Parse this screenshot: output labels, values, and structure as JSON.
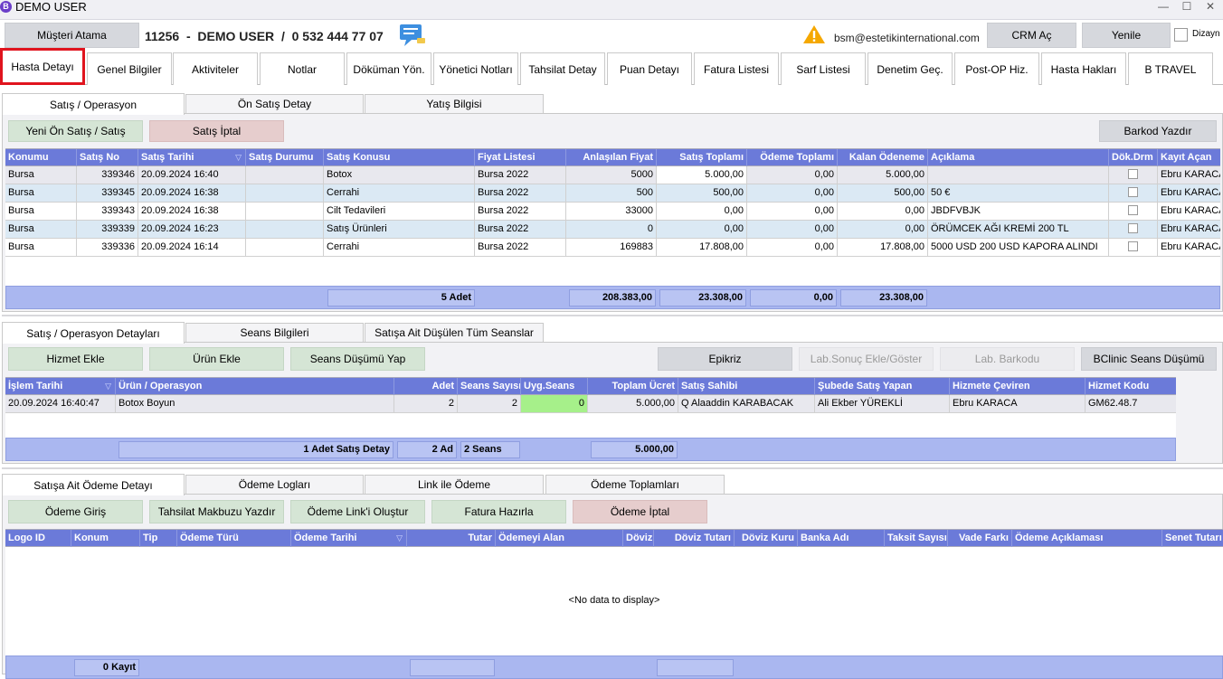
{
  "window": {
    "title": "DEMO USER",
    "logo_letter": "B",
    "minimize": "—",
    "maximize": "☐",
    "close": "✕"
  },
  "top": {
    "musteri_atama": "Müşteri Atama",
    "patient_line": "11256  -  DEMO USER  /  0 532 444 77 07",
    "email": "bsm@estetikinternational.com",
    "crm": "CRM Aç",
    "yenile": "Yenile",
    "dizayn": "Dizayn"
  },
  "main_tabs": [
    "Hasta Detayı",
    "Genel Bilgiler",
    "Aktiviteler",
    "Notlar",
    "Döküman Yön.",
    "Yönetici Notları",
    "Tahsilat Detay",
    "Puan Detayı",
    "Fatura Listesi",
    "Sarf Listesi",
    "Denetim Geç.",
    "Post-OP Hiz.",
    "Hasta Hakları",
    "B TRAVEL"
  ],
  "sales": {
    "tabs": [
      "Satış / Operasyon",
      "Ön Satış Detay",
      "Yatış Bilgisi"
    ],
    "buttons": {
      "new": "Yeni Ön Satış / Satış",
      "cancel": "Satış İptal",
      "barcode": "Barkod Yazdır"
    },
    "columns": [
      "Konumu",
      "Satış No",
      "Satış Tarihi",
      "Satış Durumu",
      "Satış Konusu",
      "Fiyat Listesi",
      "Anlaşılan Fiyat",
      "Satış Toplamı",
      "Ödeme Toplamı",
      "Kalan Ödeneme",
      "Açıklama",
      "Dök.Drm",
      "Kayıt Açan"
    ],
    "rows": [
      [
        "Bursa",
        "339346",
        "20.09.2024 16:40",
        "",
        "Botox",
        "Bursa 2022",
        "5000",
        "5.000,00",
        "0,00",
        "5.000,00",
        "",
        "",
        "Ebru KARACA"
      ],
      [
        "Bursa",
        "339345",
        "20.09.2024 16:38",
        "",
        "Cerrahi",
        "Bursa 2022",
        "500",
        "500,00",
        "0,00",
        "500,00",
        "50 €",
        "",
        "Ebru KARACA"
      ],
      [
        "Bursa",
        "339343",
        "20.09.2024 16:38",
        "",
        "Cilt Tedavileri",
        "Bursa 2022",
        "33000",
        "0,00",
        "0,00",
        "0,00",
        "JBDFVBJK",
        "",
        "Ebru KARACA"
      ],
      [
        "Bursa",
        "339339",
        "20.09.2024 16:23",
        "",
        "Satış Ürünleri",
        "Bursa 2022",
        "0",
        "0,00",
        "0,00",
        "0,00",
        "ÖRÜMCEK AĞI KREMİ 200 TL",
        "",
        "Ebru KARACA"
      ],
      [
        "Bursa",
        "339336",
        "20.09.2024 16:14",
        "",
        "Cerrahi",
        "Bursa 2022",
        "169883",
        "17.808,00",
        "0,00",
        "17.808,00",
        "5000 USD 200 USD KAPORA ALINDI",
        "",
        "Ebru KARACA"
      ]
    ],
    "footer": {
      "count": "5 Adet",
      "fiyat": "208.383,00",
      "toplam": "23.308,00",
      "odeme": "0,00",
      "kalan": "23.308,00"
    }
  },
  "details": {
    "tabs": [
      "Satış / Operasyon Detayları",
      "Seans Bilgileri",
      "Satışa Ait Düşülen Tüm Seanslar"
    ],
    "buttons": {
      "hizmet": "Hizmet Ekle",
      "urun": "Ürün Ekle",
      "seans": "Seans Düşümü Yap",
      "epikriz": "Epikriz",
      "lab_sonuc": "Lab.Sonuç Ekle/Göster",
      "lab_barkod": "Lab. Barkodu",
      "bclinic": "BClinic Seans Düşümü"
    },
    "columns": [
      "İşlem Tarihi",
      "Ürün / Operasyon",
      "Adet",
      "Seans Sayısı",
      "Uyg.Seans",
      "Toplam Ücret",
      "Satış Sahibi",
      "Şubede Satış Yapan",
      "Hizmete Çeviren",
      "Hizmet Kodu"
    ],
    "rows": [
      [
        "20.09.2024 16:40:47",
        "Botox Boyun",
        "2",
        "2",
        "0",
        "5.000,00",
        "Q Alaaddin KARABACAK",
        "Ali Ekber YÜREKLİ",
        "Ebru KARACA",
        "GM62.48.7"
      ]
    ],
    "footer": {
      "count": "1 Adet Satış Detay",
      "adet": "2 Ad",
      "seans": "2 Seans",
      "ucret": "5.000,00"
    }
  },
  "payments": {
    "tabs": [
      "Satışa Ait Ödeme Detayı",
      "Ödeme Logları",
      "Link ile Ödeme",
      "Ödeme Toplamları"
    ],
    "buttons": {
      "giris": "Ödeme Giriş",
      "makbuz": "Tahsilat Makbuzu Yazdır",
      "link": "Ödeme Link'i Oluştur",
      "fatura": "Fatura Hazırla",
      "iptal": "Ödeme İptal"
    },
    "columns": [
      "Logo ID",
      "Konum",
      "Tip",
      "Ödeme Türü",
      "Ödeme Tarihi",
      "Tutar",
      "Ödemeyi Alan",
      "Döviz",
      "Döviz Tutarı",
      "Döviz Kuru",
      "Banka Adı",
      "Taksit Sayısı",
      "Vade Farkı",
      "Ödeme Açıklaması",
      "Senet Tutarı"
    ],
    "empty": "<No data to display>",
    "footer": {
      "count": "0 Kayıt"
    }
  },
  "colors": {
    "header": "#6b7ad9",
    "footer": "#aab7f0",
    "row_alt": "#dbe9f4",
    "row_selected": "#e8e8ee",
    "uyg_seans": "#a6f08a",
    "active_tab_border": "#e0141e",
    "warning": "#f5a800",
    "chat": "#3d8fe0"
  }
}
